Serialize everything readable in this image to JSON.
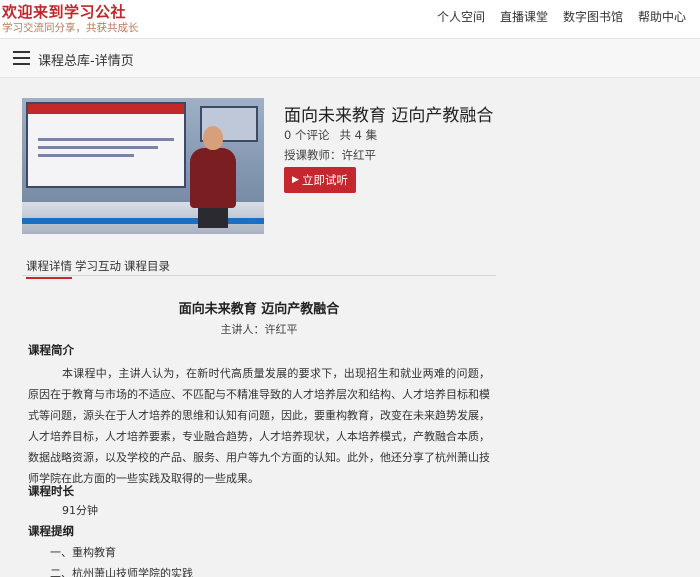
{
  "header": {
    "brand_title": "欢迎来到学习公社",
    "brand_subtitle": "学习交流同分享，共获共成长",
    "nav": [
      "个人空间",
      "直播课堂",
      "数字图书馆",
      "帮助中心"
    ]
  },
  "subheader": {
    "title": "课程总库-详情页"
  },
  "course": {
    "title": "面向未来教育 迈向产教融合",
    "comments": "0 个评论",
    "episodes": "共 4 集",
    "teacher": "授课教师：许红平",
    "trial_label": "立即试听"
  },
  "tabs": [
    "课程详情",
    "学习互动",
    "课程目录"
  ],
  "detail": {
    "title": "面向未来教育 迈向产教融合",
    "host": "主讲人：许红平",
    "intro_heading": "课程简介",
    "intro_text": "本课程中，主讲人认为，在新时代高质量发展的要求下，出现招生和就业两难的问题，原因在于教育与市场的不适应、不匹配与不精准导致的人才培养层次和结构、人才培养目标和模式等问题，源头在于人才培养的思维和认知有问题，因此，要重构教育，改变在未来趋势发展，人才培养目标，人才培养要素，专业融合趋势，人才培养现状，人本培养模式，产教融合本质，数据战略资源，以及学校的产品、服务、用户等九个方面的认知。此外，他还分享了杭州萧山技师学院在此方面的一些实践及取得的一些成果。",
    "duration_heading": "课程时长",
    "duration_value": "91分钟",
    "outline_heading": "课程提纲",
    "outline": [
      "一、重构教育",
      "二、杭州萧山技师学院的实践"
    ]
  }
}
